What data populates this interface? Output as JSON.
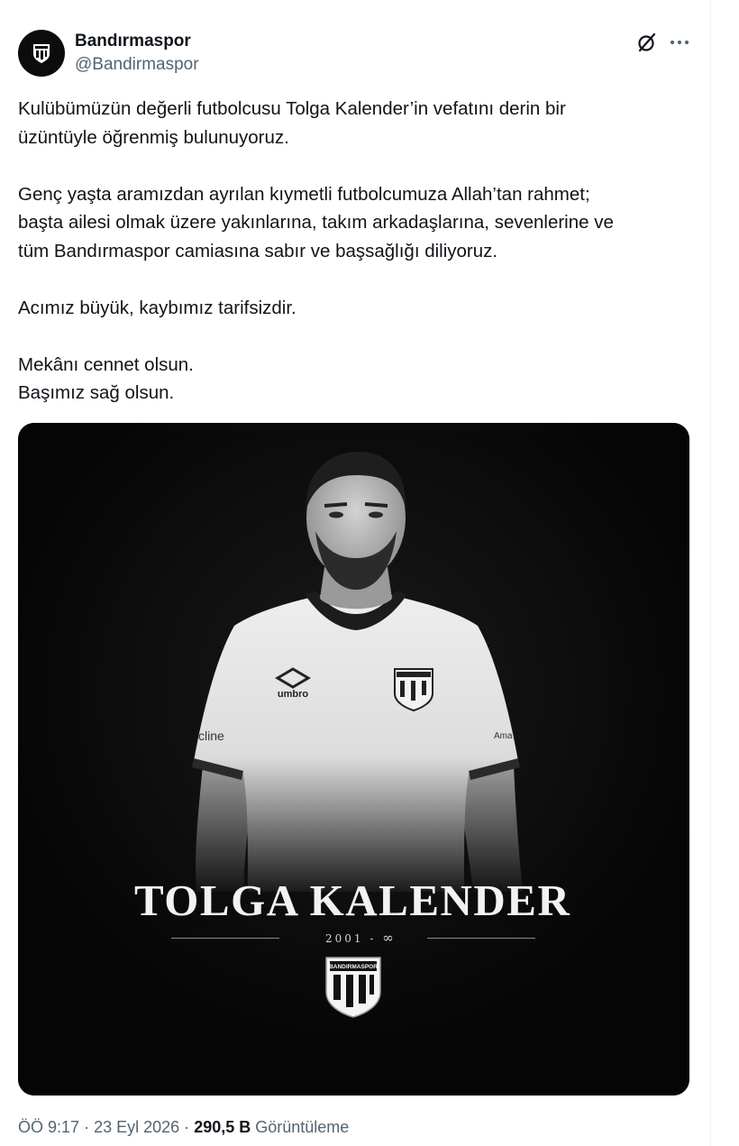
{
  "author": {
    "display_name": "Bandırmaspor",
    "handle": "@Bandirmaspor"
  },
  "header_icons": [
    "grok-icon",
    "more-icon"
  ],
  "tweet_lines": [
    "Kulübümüzün değerli futbolcusu Tolga Kalender’in vefatını derin bir",
    "üzüntüyle öğrenmiş bulunuyoruz.",
    "Genç yaşta aramızdan ayrılan kıymetli futbolcumuza Allah’tan rahmet;",
    "başta ailesi olmak üzere yakınlarına, takım arkadaşlarına, sevenlerine ve",
    "tüm Bandırmaspor camiasına sabır ve başsağlığı diliyoruz.",
    "Acımız büyük, kaybımız tarifsizdir.",
    "Mekânı cennet olsun.",
    "Başımız sağ olsun."
  ],
  "media": {
    "player_name": "TOLGA KALENDER",
    "years": "2001 -",
    "years_symbol": "∞",
    "jersey_brand": "umbro",
    "sleeve_text_left": "cline",
    "sleeve_text_right": "Ama",
    "crest_text": "BANDIRMASPOR"
  },
  "meta": {
    "time": "ÖÖ 9:17",
    "separator": "·",
    "date": "23 Eyl 2026",
    "views_count": "290,5 B",
    "views_label": "Görüntüleme"
  },
  "colors": {
    "text_primary": "#0f1419",
    "text_secondary": "#536471",
    "media_bg": "#050505"
  }
}
